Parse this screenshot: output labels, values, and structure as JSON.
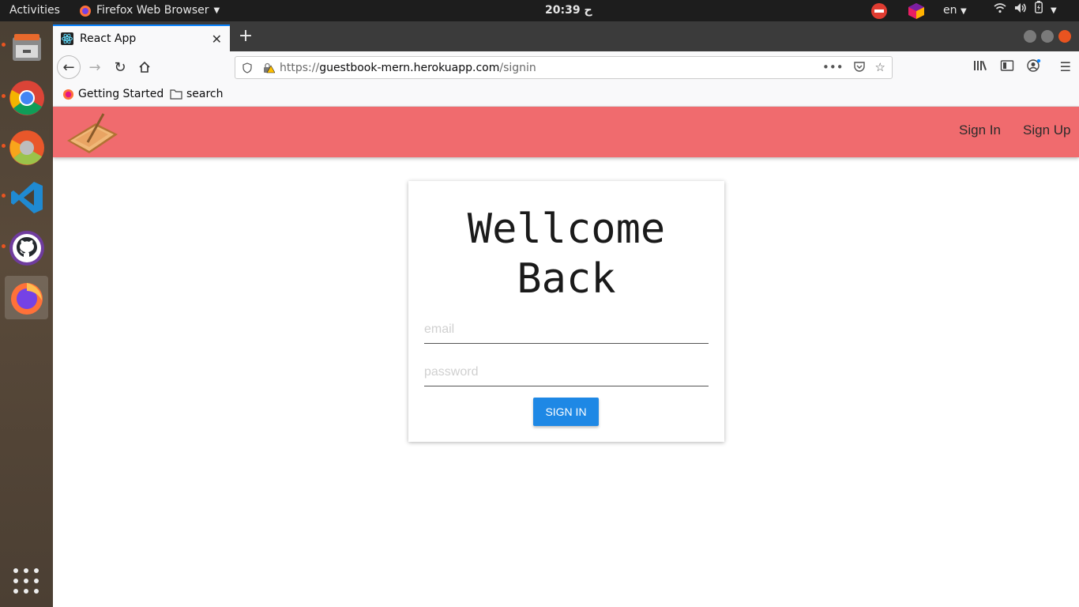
{
  "topbar": {
    "activities": "Activities",
    "app_name": "Firefox Web Browser",
    "clock": "20:39 ح",
    "language": "en"
  },
  "dock": {
    "items": [
      "files-icon",
      "chrome-icon",
      "chrome-beta-icon",
      "vscode-icon",
      "github-desktop-icon",
      "firefox-icon"
    ]
  },
  "browser": {
    "tab_title": "React App",
    "url_scheme": "https://",
    "url_host": "guestbook-mern.herokuapp.com",
    "url_path": "/signin",
    "bookmarks": [
      "Getting Started",
      "search"
    ]
  },
  "app": {
    "nav_signin": "Sign In",
    "nav_signup": "Sign Up",
    "title_line1": "Wellcome",
    "title_line2": "Back",
    "email_placeholder": "email",
    "password_placeholder": "password",
    "signin_button": "SIGN IN"
  },
  "colors": {
    "appbar": "#f06b6e",
    "button": "#1e88e5",
    "tab_accent": "#0a84ff"
  }
}
